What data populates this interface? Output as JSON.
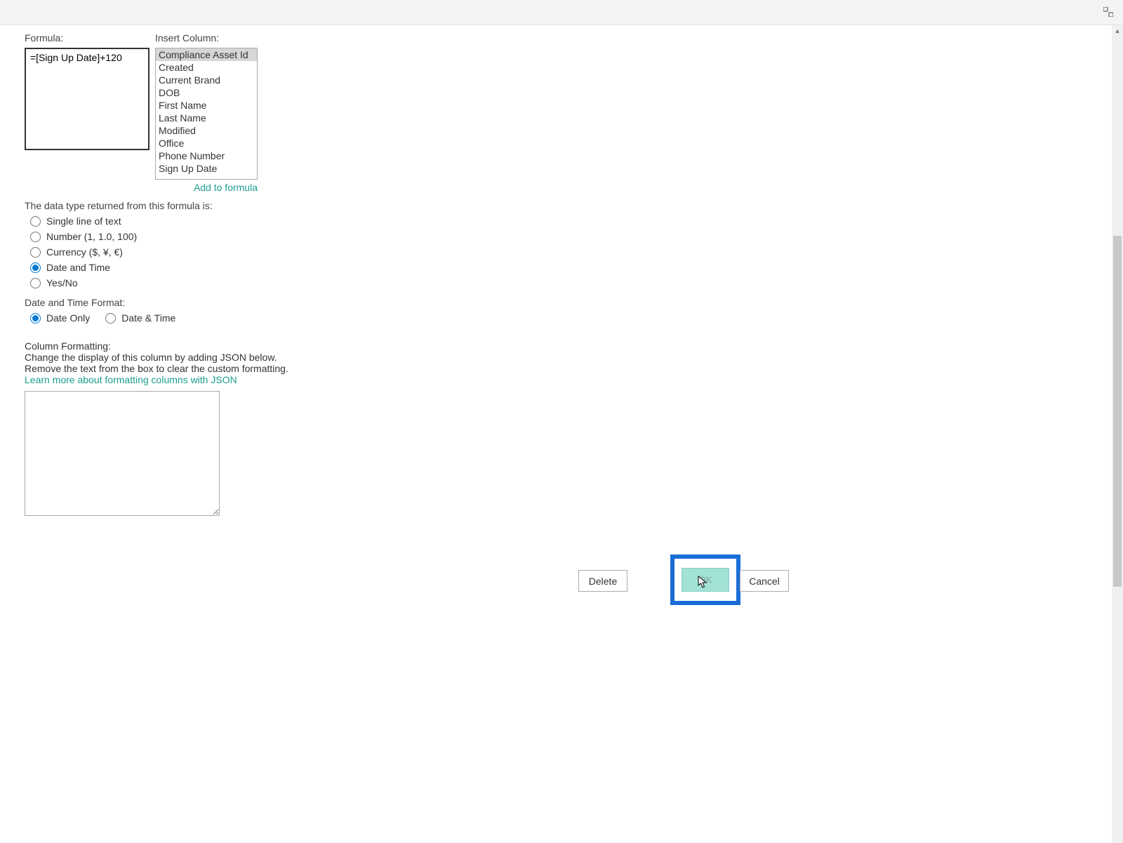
{
  "labels": {
    "formula": "Formula:",
    "insertColumn": "Insert Column:"
  },
  "formula_value": "=[Sign Up Date]+120",
  "columns": [
    "Compliance Asset Id",
    "Created",
    "Current Brand",
    "DOB",
    "First Name",
    "Last Name",
    "Modified",
    "Office",
    "Phone Number",
    "Sign Up Date"
  ],
  "selected_column_index": 0,
  "add_to_formula": "Add to formula",
  "dataTypeHeading": "The data type returned from this formula is:",
  "dataTypes": {
    "single": "Single line of text",
    "number": "Number (1, 1.0, 100)",
    "currency": "Currency ($, ¥, €)",
    "datetime": "Date and Time",
    "yesno": "Yes/No"
  },
  "dataType_selected": "datetime",
  "dateFormatLabel": "Date and Time Format:",
  "dateFormats": {
    "dateOnly": "Date Only",
    "dateTime": "Date & Time"
  },
  "dateFormat_selected": "dateOnly",
  "columnFormatting": {
    "heading": "Column Formatting:",
    "line1": "Change the display of this column by adding JSON below.",
    "line2": "Remove the text from the box to clear the custom formatting.",
    "link": "Learn more about formatting columns with JSON"
  },
  "json_value": "",
  "buttons": {
    "delete": "Delete",
    "ok": "OK",
    "cancel": "Cancel"
  }
}
